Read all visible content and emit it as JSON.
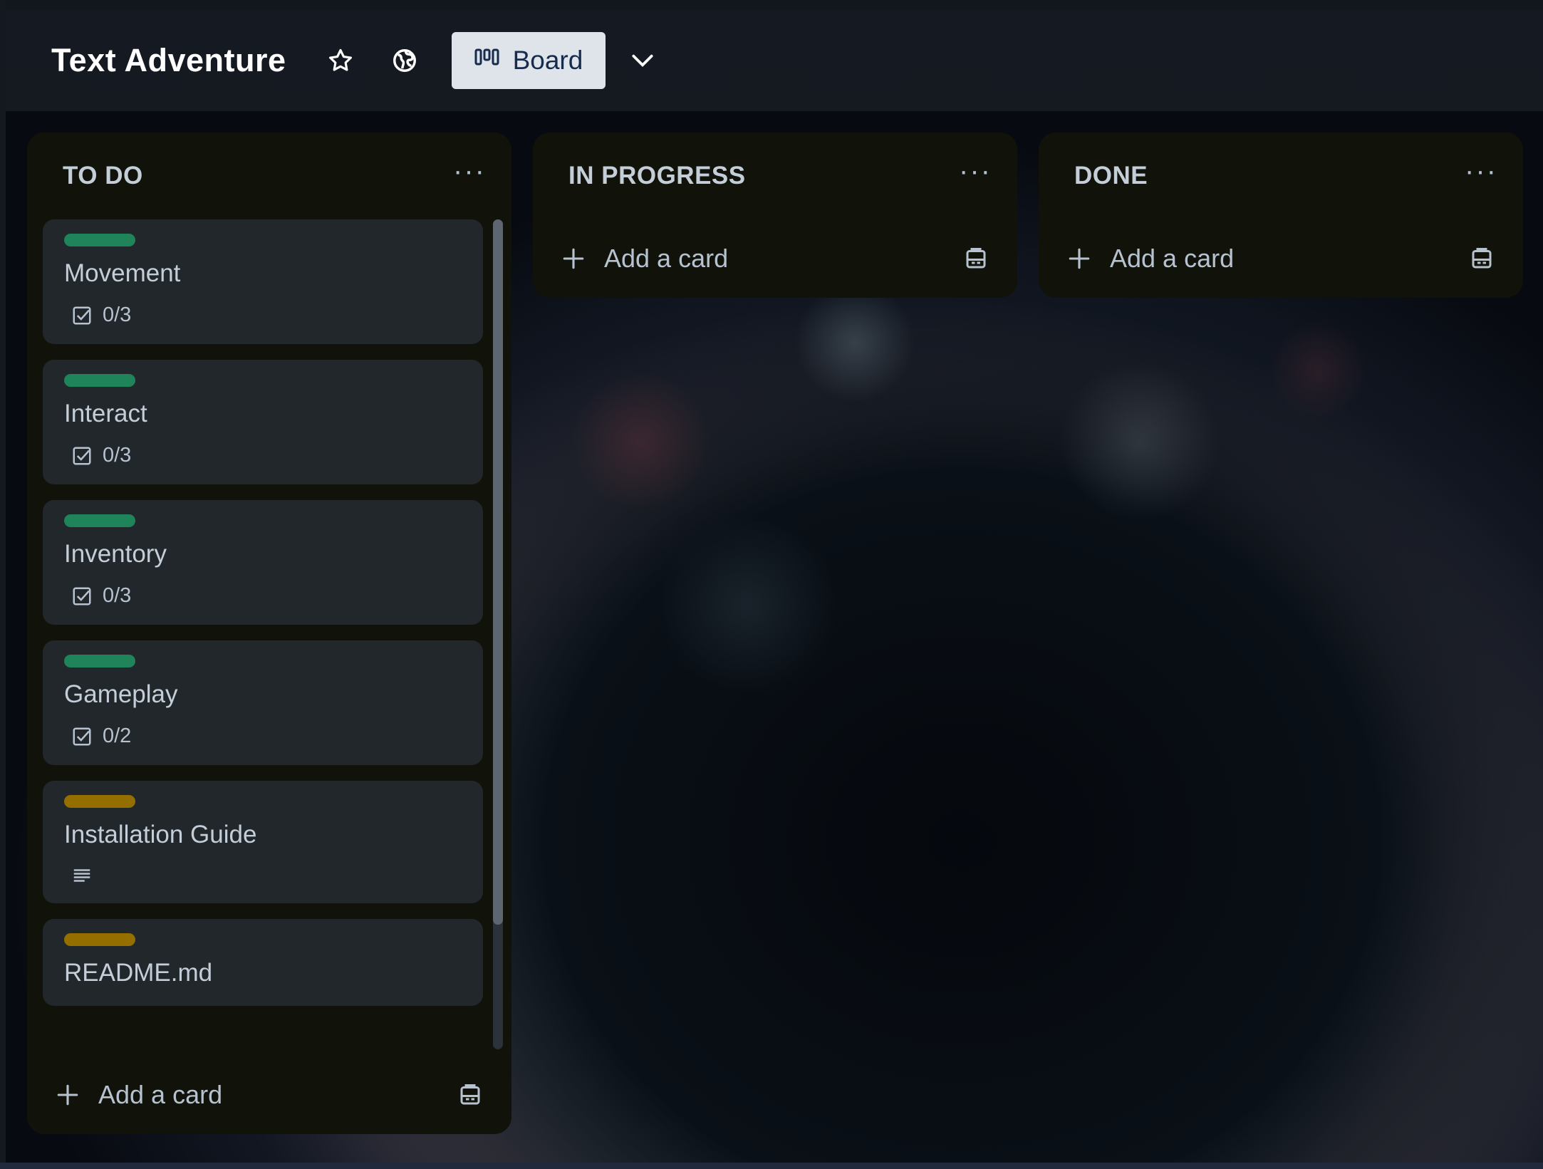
{
  "board": {
    "title": "Text Adventure",
    "view_label": "Board",
    "icons": [
      "star-icon",
      "globe-icon",
      "board-view-icon",
      "chevron-down-icon"
    ]
  },
  "colors": {
    "label_green": "#1f845a",
    "label_yellow": "#946f00",
    "view_button_bg": "#dfe3ea",
    "list_bg": "#11130a",
    "card_bg": "#22272b"
  },
  "lists": [
    {
      "title": "TO DO",
      "add_label": "Add a card",
      "cards": [
        {
          "title": "Movement",
          "label_color": "#1f845a",
          "checklist": "0/3"
        },
        {
          "title": "Interact",
          "label_color": "#1f845a",
          "checklist": "0/3"
        },
        {
          "title": "Inventory",
          "label_color": "#1f845a",
          "checklist": "0/3"
        },
        {
          "title": "Gameplay",
          "label_color": "#1f845a",
          "checklist": "0/2"
        },
        {
          "title": "Installation Guide",
          "label_color": "#946f00",
          "has_description": true
        },
        {
          "title": "README.md",
          "label_color": "#946f00"
        }
      ]
    },
    {
      "title": "IN PROGRESS",
      "add_label": "Add a card",
      "cards": []
    },
    {
      "title": "DONE",
      "add_label": "Add a card",
      "cards": []
    }
  ]
}
